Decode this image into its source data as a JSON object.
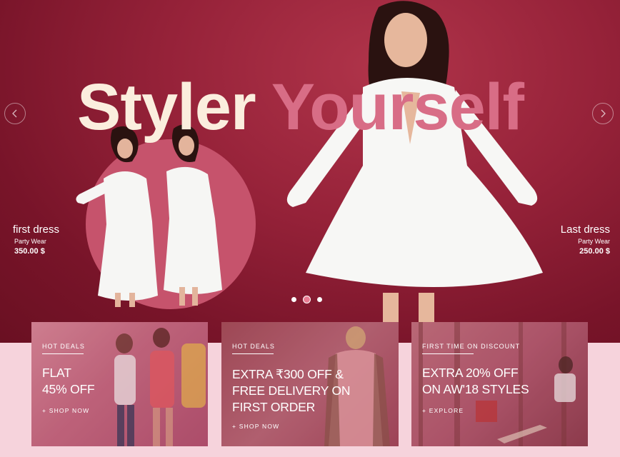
{
  "hero": {
    "top_text": "",
    "title_word1": "Styler",
    "title_word2": "Yourself",
    "left_product": {
      "name": "first dress",
      "category": "Party Wear",
      "price": "350.00 $"
    },
    "right_product": {
      "name": "Last dress",
      "category": "Party Wear",
      "price": "250.00 $"
    },
    "slider": {
      "count": 3,
      "active_index": 1
    }
  },
  "promos": [
    {
      "tag": "HOT DEALS",
      "headline_line1": "FLAT",
      "headline_line2": "45% OFF",
      "headline_line3": "",
      "cta": "+ SHOP NOW"
    },
    {
      "tag": "HOT DEALS",
      "headline_line1": "EXTRA ₹300 OFF &",
      "headline_line2": "FREE DELIVERY ON",
      "headline_line3": "FIRST ORDER",
      "cta": "+ SHOP NOW"
    },
    {
      "tag": "FIRST TIME ON DISCOUNT",
      "headline_line1": "EXTRA 20% OFF",
      "headline_line2": "ON AW'18 STYLES",
      "headline_line3": "",
      "cta": "+ EXPLORE"
    }
  ],
  "colors": {
    "hero_bg": "#962239",
    "title_light": "#fbeede",
    "title_pink": "#d86d86",
    "page_bg": "#f6d3dc"
  },
  "icons": [
    "chevron-left-icon",
    "chevron-right-icon"
  ]
}
